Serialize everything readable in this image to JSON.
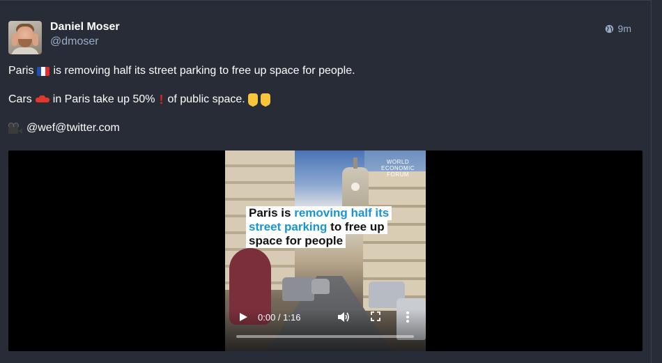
{
  "status": {
    "author": {
      "display_name": "Daniel Moser",
      "username": "@dmoser",
      "avatar_icon": "avatar-photo"
    },
    "visibility_icon": "globe-icon",
    "relative_time": "9m",
    "content": {
      "line1_before": "Paris",
      "line1_after": "is removing half its street parking to free up space for people.",
      "line2_a": "Cars",
      "line2_b": "in Paris take up 50%",
      "line2_c": "of public space.",
      "line3": "@wef@twitter.com"
    },
    "media": {
      "logo_text": "WORLD ECONOMIC FORUM",
      "logo_line1": "WORLD",
      "logo_line2": "ECONOMIC",
      "logo_line3": "FORUM",
      "headline": {
        "l1_a": "Paris is ",
        "l1_b": "removing half its",
        "l2_a": "street parking",
        "l2_b": " to free up",
        "l3": "space for people"
      },
      "time_display": "0:00 / 1:16",
      "progress_fraction": 0
    }
  }
}
